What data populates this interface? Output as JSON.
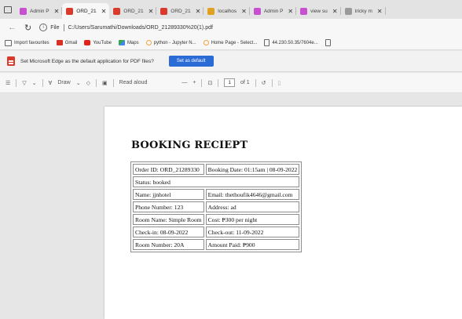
{
  "browser": {
    "tabs": [
      {
        "title": "Admin P",
        "favicon_color": "#c84fd0",
        "active": false
      },
      {
        "title": "ORD_21",
        "favicon_color": "#d93a2b",
        "active": true
      },
      {
        "title": "ORD_21",
        "favicon_color": "#d93a2b",
        "active": false
      },
      {
        "title": "ORD_21",
        "favicon_color": "#d93a2b",
        "active": false
      },
      {
        "title": "localhos",
        "favicon_color": "#e0a020",
        "active": false
      },
      {
        "title": "Admin P",
        "favicon_color": "#c84fd0",
        "active": false
      },
      {
        "title": "view su",
        "favicon_color": "#c84fd0",
        "active": false
      },
      {
        "title": "tricky m",
        "favicon_color": "#9a9a9a",
        "active": false
      }
    ],
    "address": {
      "scheme_label": "File",
      "url": "C:/Users/Sarumathi/Downloads/ORD_21289330%20(1).pdf"
    },
    "bookmarks": [
      {
        "label": "Import favourites",
        "icon_color": "#666666"
      },
      {
        "label": "Gmail",
        "icon_color": "#d93025"
      },
      {
        "label": "YouTube",
        "icon_color": "#e62117"
      },
      {
        "label": "Maps",
        "icon_color": "#34a853"
      },
      {
        "label": "python - Jupyter N...",
        "icon_color": "#f3a43b"
      },
      {
        "label": "Home Page - Select...",
        "icon_color": "#f3a43b"
      },
      {
        "label": "44.230.50.35/7604e...",
        "icon_color": "#666666"
      }
    ],
    "default_prompt": {
      "text": "Set Microsoft Edge as the default application for PDF files?",
      "button": "Set as default"
    },
    "pdf_toolbar": {
      "draw_label": "Draw",
      "read_aloud_label": "Read aloud",
      "zoom_out": "—",
      "zoom_in": "+",
      "page_number": "1",
      "page_total": "of 1"
    }
  },
  "receipt": {
    "title": "BOOKING RECIEPT",
    "order_id": "Order ID: ORD_21289330",
    "booking_date": "Booking Date: 01:15am | 08-09-2022",
    "status": "Status: booked",
    "name": "Name: jjnhotel",
    "email": "Email: thethoufik4646@gmail.com",
    "phone": "Phone Number: 123",
    "address": "Address: ad",
    "room_name": "Room Name: Simple Room",
    "cost": "Cost: ₱300 per night",
    "check_in": "Check-in: 08-09-2022",
    "check_out": "Check-out: 11-09-2022",
    "room_number": "Room Number: 20A",
    "amount_paid": "Amount Paid: ₱900"
  }
}
